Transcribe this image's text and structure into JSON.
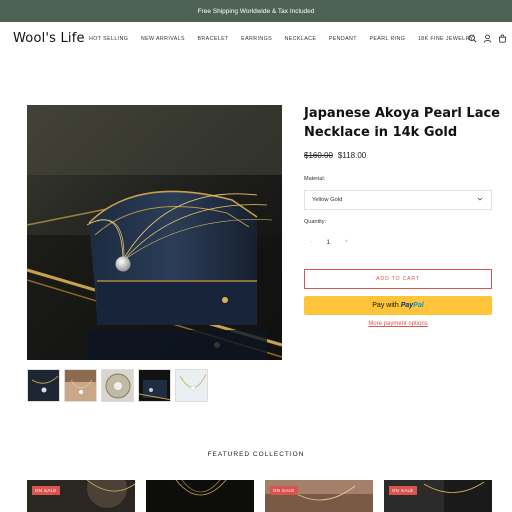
{
  "announcement": "Free Shipping Worldwide & Tax Included",
  "header": {
    "logo": "Wool's Life",
    "nav": [
      "HOT SELLING",
      "NEW ARRIVALS",
      "BRACELET",
      "EARRINGS",
      "NECKLACE",
      "PENDANT",
      "PEARL RING",
      "18K FINE JEWELRY"
    ],
    "icons": [
      "search-icon",
      "account-icon",
      "cart-icon"
    ]
  },
  "product": {
    "title": "Japanese Akoya Pearl Lace Necklace in 14k Gold",
    "price_old": "$160.00",
    "price_new": "$118.00",
    "material_label": "Material:",
    "material_value": "Yellow Gold",
    "quantity_label": "Quantity:",
    "quantity_value": "1",
    "quantity_minus": "-",
    "quantity_plus": "+",
    "add_to_cart": "ADD TO CART",
    "paypal_prefix": "Pay with",
    "paypal_brand_1": "Pay",
    "paypal_brand_2": "Pal",
    "more_payment": "More payment options",
    "thumbnail_count": 5
  },
  "featured": {
    "heading": "FEATURED COLLECTION",
    "badges": [
      "ON SALE",
      "",
      "ON SALE",
      "ON SALE"
    ]
  },
  "colors": {
    "announcement_bg": "#4d6252",
    "accent": "#d9534f",
    "paypal_bg": "#ffc439"
  }
}
